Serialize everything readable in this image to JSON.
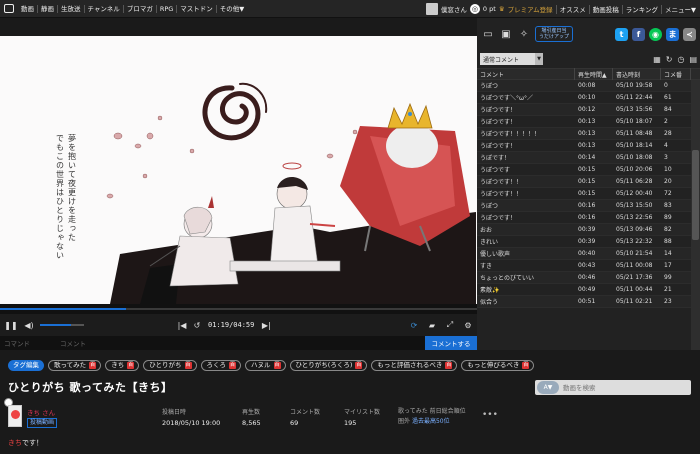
{
  "topbar": {
    "nav": [
      "動画",
      "静画",
      "生放送",
      "チャンネル",
      "ブロマガ",
      "RPG",
      "マストドン",
      "その他▼"
    ],
    "username": "僕窓さん",
    "points": "0 pt",
    "premium": "プレミアム登録",
    "links": [
      "オススメ",
      "動画投稿",
      "ランキング",
      "メニュー▼"
    ]
  },
  "player": {
    "time": "01:19/04:59",
    "progress": 0.264,
    "volume": 0.7,
    "command_placeholder": "コマンド",
    "comment_placeholder": "コメント",
    "send_label": "コメントする"
  },
  "artwork": {
    "lyric_line1": "夢を抱いて夜更けを走った",
    "lyric_line2": "でもこの世界はひとりじゃない"
  },
  "panel": {
    "bubble_text": "場引産日当\nうだけアップ",
    "filter_label": "通常コメント",
    "headers": [
      "コメント",
      "再生時間▲",
      "書込時刻",
      "コメ番"
    ],
    "comments": [
      {
        "text": "うぽつ",
        "time": "00:08",
        "date": "05/10 19:58",
        "no": "0"
      },
      {
        "text": "うぽつです＼°ω°／",
        "time": "00:10",
        "date": "05/11 22:44",
        "no": "61"
      },
      {
        "text": "うぽつです！",
        "time": "00:12",
        "date": "05/13 15:56",
        "no": "84"
      },
      {
        "text": "うぽつです！",
        "time": "00:13",
        "date": "05/10 18:07",
        "no": "2"
      },
      {
        "text": "うぽつです！！！！！",
        "time": "00:13",
        "date": "05/11 08:48",
        "no": "28"
      },
      {
        "text": "うぽつです！",
        "time": "00:13",
        "date": "05/10 18:14",
        "no": "4"
      },
      {
        "text": "うぽです！",
        "time": "00:14",
        "date": "05/10 18:08",
        "no": "3"
      },
      {
        "text": "うぽつです",
        "time": "00:15",
        "date": "05/10 20:06",
        "no": "10"
      },
      {
        "text": "うぽつです！！",
        "time": "00:15",
        "date": "05/11 06:28",
        "no": "20"
      },
      {
        "text": "うぽつです！！",
        "time": "00:15",
        "date": "05/12 00:40",
        "no": "72"
      },
      {
        "text": "うぽつ",
        "time": "00:16",
        "date": "05/13 15:50",
        "no": "83"
      },
      {
        "text": "うぽつです！",
        "time": "00:16",
        "date": "05/13 22:56",
        "no": "89"
      },
      {
        "text": "おお",
        "time": "00:39",
        "date": "05/13 09:46",
        "no": "82"
      },
      {
        "text": "きれい",
        "time": "00:39",
        "date": "05/13 22:32",
        "no": "88"
      },
      {
        "text": "優しい歌声",
        "time": "00:40",
        "date": "05/10 21:54",
        "no": "14"
      },
      {
        "text": "すき",
        "time": "00:43",
        "date": "05/11 00:08",
        "no": "17"
      },
      {
        "text": "ちょっとのびていい",
        "time": "00:46",
        "date": "05/21 17:36",
        "no": "99"
      },
      {
        "text": "素敵✨",
        "time": "00:49",
        "date": "05/11 00:44",
        "no": "21"
      },
      {
        "text": "似合う",
        "time": "00:51",
        "date": "05/11 02:21",
        "no": "23"
      }
    ]
  },
  "tags": {
    "edit_label": "タグ編集",
    "items": [
      {
        "label": "歌ってみた",
        "dic": "百"
      },
      {
        "label": "きち",
        "dic": "百"
      },
      {
        "label": "ひとりがち",
        "dic": "百"
      },
      {
        "label": "ろくろ",
        "dic": "百"
      },
      {
        "label": "ハヌル",
        "dic": "百"
      },
      {
        "label": "ひとりがち(ろくろ)",
        "dic": "百"
      },
      {
        "label": "もっと評価されるべき",
        "dic": "百"
      },
      {
        "label": "もっと伸びるべき",
        "dic": "百"
      }
    ]
  },
  "video": {
    "title": "ひとりがち 歌ってみた【きち】",
    "uploader": "きち さん",
    "uploader_badge": "投稿動画",
    "posted_label": "投稿日時",
    "posted": "2018/05/10 19:00",
    "views_label": "再生数",
    "views": "8,565",
    "comments_label": "コメント数",
    "comments": "69",
    "mylist_label": "マイリスト数",
    "mylist": "195",
    "rank_line1": "歌ってみた 前日総合順位",
    "rank_line2a": "圏外",
    "rank_line2b": "過去最高50位",
    "more": "•••",
    "desc_prefix": "きち",
    "desc_suffix": "です！"
  },
  "search": {
    "placeholder": "動画を検索",
    "mode": "A"
  }
}
